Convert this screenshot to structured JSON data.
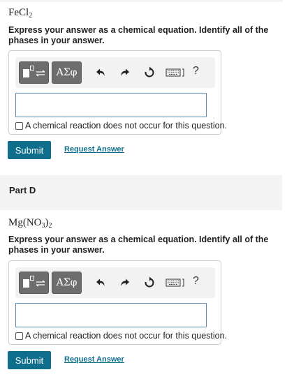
{
  "part_c": {
    "formula_main": "FeCl",
    "formula_sub": "2",
    "instructions": "Express your answer as a chemical equation. Identify all of the phases in your answer.",
    "toolbar": {
      "template_label": "templates",
      "greek_label": "ΑΣφ",
      "help_label": "?"
    },
    "answer_value": "",
    "no_reaction_label": "A chemical reaction does not occur for this question.",
    "submit_label": "Submit",
    "request_answer_label": "Request Answer"
  },
  "part_d": {
    "header": "Part D",
    "formula_main": "Mg(NO",
    "formula_sub1": "3",
    "formula_close": ")",
    "formula_sub2": "2",
    "instructions": "Express your answer as a chemical equation. Identify all of the phases in your answer.",
    "toolbar": {
      "greek_label": "ΑΣφ",
      "help_label": "?"
    },
    "answer_value": "",
    "no_reaction_label": "A chemical reaction does not occur for this question.",
    "submit_label": "Submit",
    "request_answer_label": "Request Answer"
  },
  "colors": {
    "submit_bg": "#0f6e8c",
    "link": "#0f6e8c",
    "toolbar_button": "#6d6d6d",
    "input_border": "#5a8bb5"
  },
  "icons": [
    "templates-icon",
    "greek-symbols-icon",
    "undo-icon",
    "redo-icon",
    "reset-icon",
    "keyboard-icon",
    "help-icon"
  ]
}
